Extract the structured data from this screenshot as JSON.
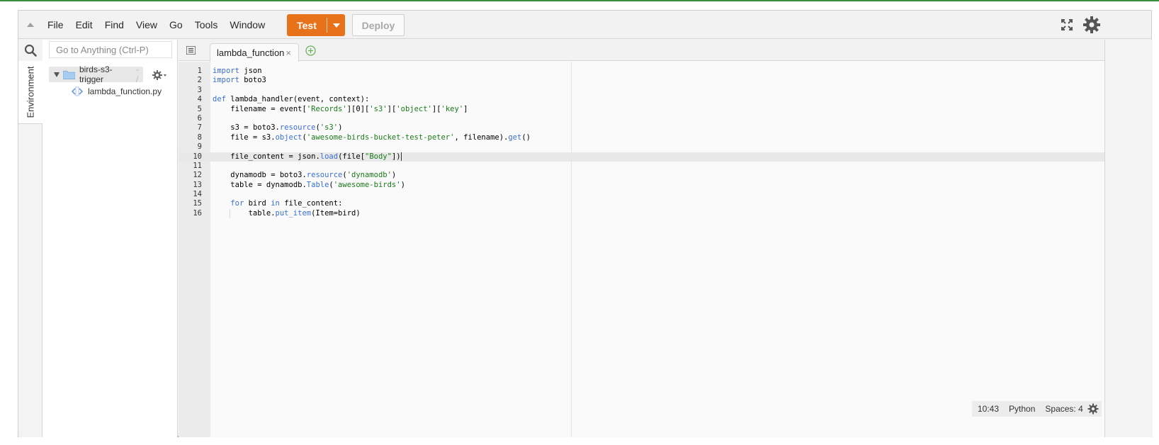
{
  "menubar": {
    "items": [
      "File",
      "Edit",
      "Find",
      "View",
      "Go",
      "Tools",
      "Window"
    ],
    "test_label": "Test",
    "deploy_label": "Deploy"
  },
  "sidebar": {
    "environment_tab": "Environment",
    "goto_placeholder": "Go to Anything (Ctrl-P)",
    "root_folder": "birds-s3-trigger",
    "root_suffix": "- /",
    "file": "lambda_function.py"
  },
  "editor": {
    "active_tab": "lambda_function",
    "tab_close": "×",
    "active_line": 10,
    "lines": [
      "import json",
      "import boto3",
      "",
      "def lambda_handler(event, context):",
      "    filename = event['Records'][0]['s3']['object']['key']",
      "",
      "    s3 = boto3.resource('s3')",
      "    file = s3.object('awesome-birds-bucket-test-peter', filename).get()",
      "",
      "    file_content = json.load(file[\"Body\"])",
      "",
      "    dynamodb = boto3.resource('dynamodb')",
      "    table = dynamodb.Table('awesome-birds')",
      "",
      "    for bird in file_content:",
      "        table.put_item(Item=bird)"
    ]
  },
  "status": {
    "cursor": "10:43",
    "language": "Python",
    "spaces": "Spaces: 4"
  },
  "colors": {
    "test_button": "#e8721a",
    "keyword": "#3a6fd0",
    "string": "#1a7a1a"
  }
}
